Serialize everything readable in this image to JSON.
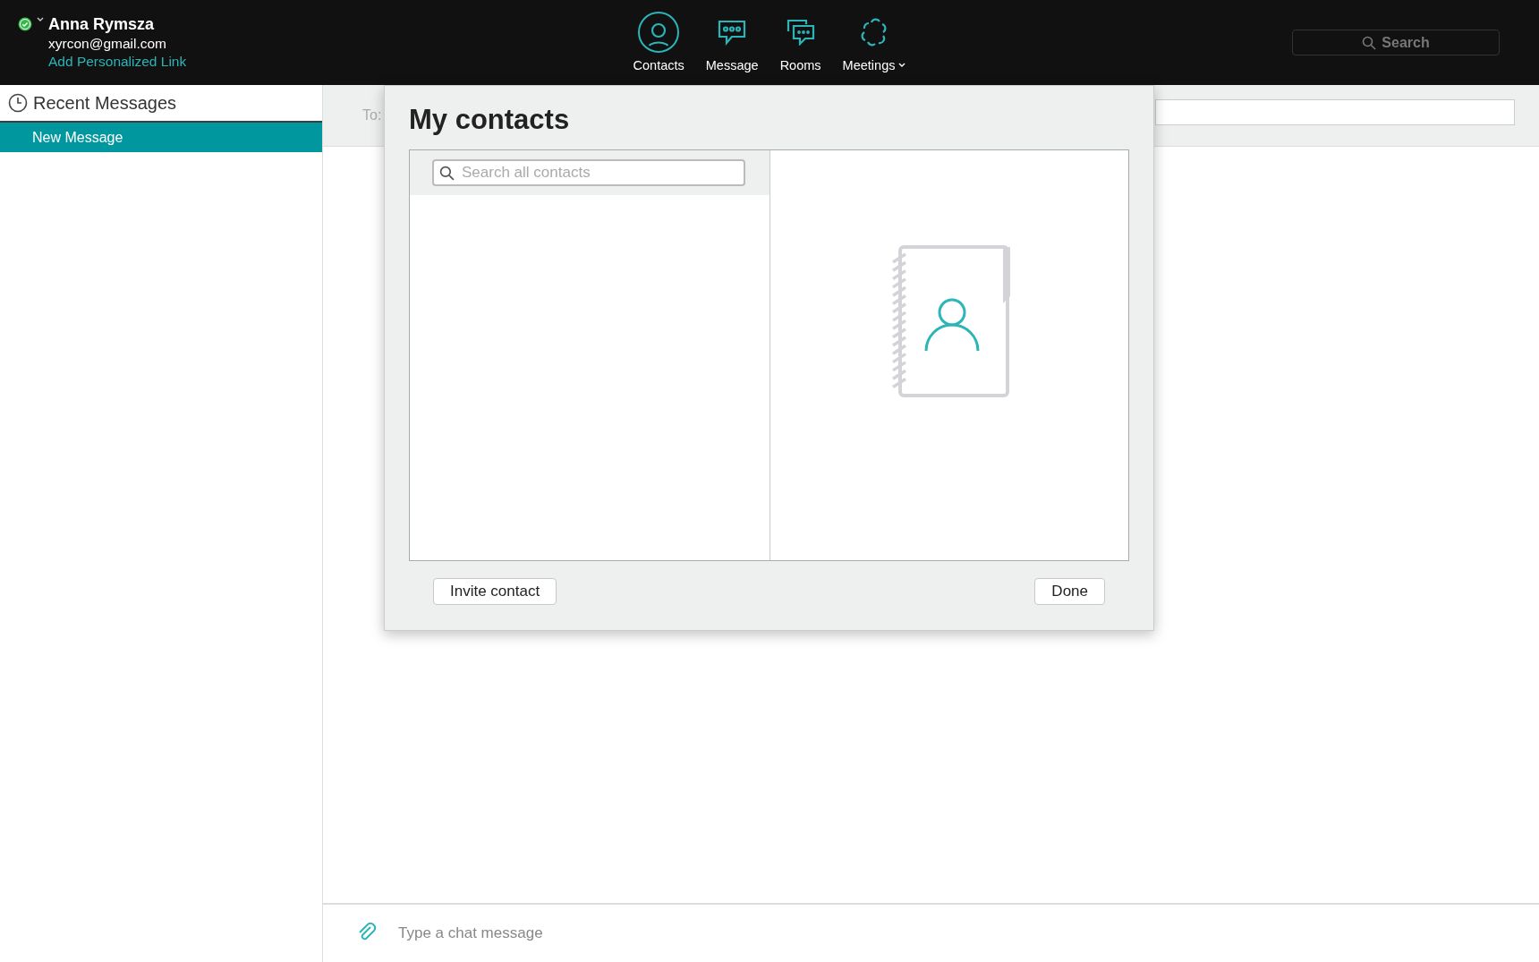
{
  "user": {
    "name": "Anna Rymsza",
    "email": "xyrcon@gmail.com",
    "link": "Add Personalized Link",
    "online": true
  },
  "nav": [
    {
      "kind": "contacts",
      "label": "Contacts",
      "selected": true,
      "dropdown": false
    },
    {
      "kind": "message",
      "label": "Message",
      "selected": false,
      "dropdown": false
    },
    {
      "kind": "rooms",
      "label": "Rooms",
      "selected": false,
      "dropdown": false
    },
    {
      "kind": "meetings",
      "label": "Meetings",
      "selected": false,
      "dropdown": true
    }
  ],
  "search": {
    "placeholder": "Search"
  },
  "sidebar": {
    "title": "Recent Messages",
    "items": [
      {
        "label": "New Message",
        "selected": true
      }
    ]
  },
  "chat": {
    "to_label": "To:",
    "composer_placeholder": "Type a chat message"
  },
  "dialog": {
    "title": "My contacts",
    "search_placeholder": "Search all contacts",
    "buttons": [
      {
        "kind": "invite",
        "label": "Invite contact"
      },
      {
        "kind": "done",
        "label": "Done"
      }
    ]
  }
}
